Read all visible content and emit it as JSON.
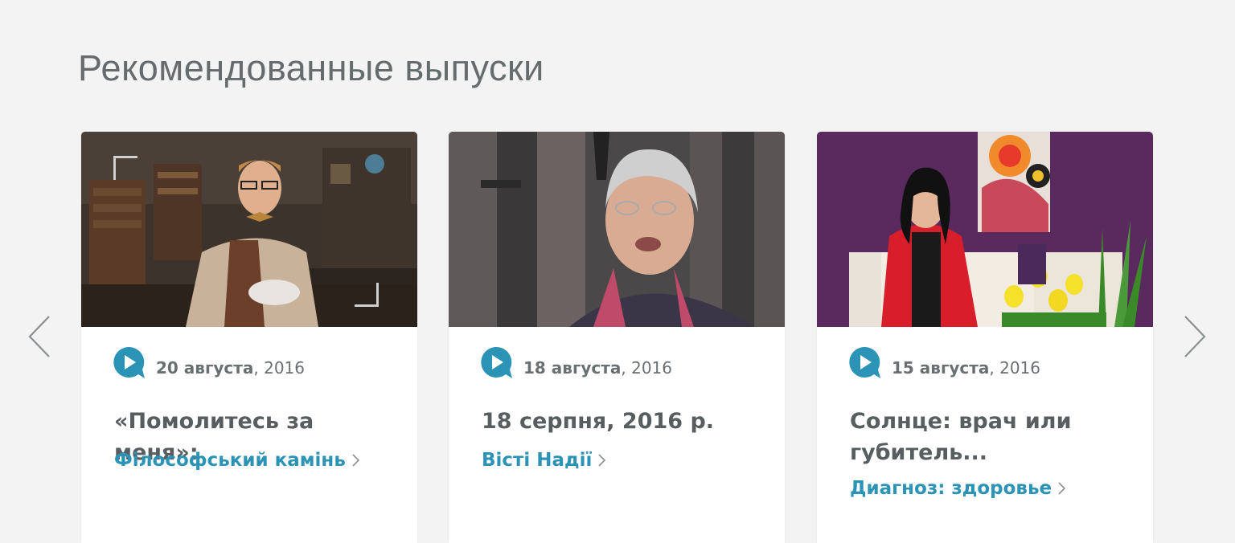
{
  "section": {
    "title": "Рекомендованные выпуски"
  },
  "colors": {
    "background": "#f3f3f3",
    "accent": "#2b93b6",
    "title_text": "#585d5f",
    "meta_text": "#6a6f71"
  },
  "nav": {
    "prev_icon": "chevron-left-icon",
    "next_icon": "chevron-right-icon"
  },
  "cards": [
    {
      "date_day": "20 августа",
      "date_year": ", 2016",
      "title": "«Помолитесь за меня»:",
      "program": "Філософський камінь",
      "icon": "play-bubble-icon"
    },
    {
      "date_day": "18 августа",
      "date_year": ", 2016",
      "title": "18 серпня, 2016 р.",
      "program": "Вісті Надії",
      "icon": "play-bubble-icon"
    },
    {
      "date_day": "15 августа",
      "date_year": ", 2016",
      "title": "Солнце: врач или губитель...",
      "program": "Диагноз: здоровье",
      "icon": "play-bubble-icon"
    }
  ]
}
